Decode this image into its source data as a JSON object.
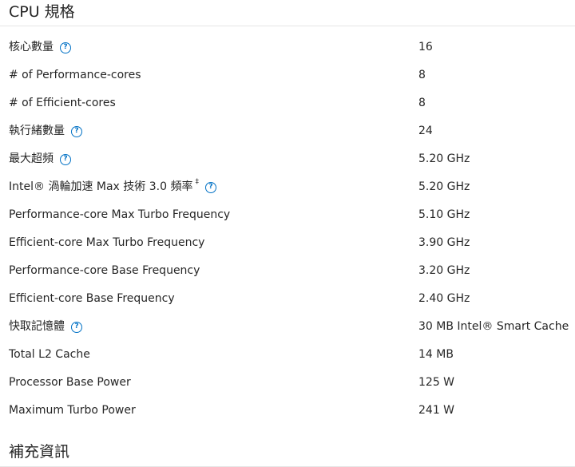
{
  "sections": {
    "cpu_specs_title": "CPU 規格",
    "extra_info_title": "補充資訊"
  },
  "specs": [
    {
      "label": "核心數量",
      "value": "16",
      "help": true,
      "mark": ""
    },
    {
      "label": "# of Performance-cores",
      "value": "8",
      "help": false,
      "mark": ""
    },
    {
      "label": "# of Efficient-cores",
      "value": "8",
      "help": false,
      "mark": ""
    },
    {
      "label": "執行緒數量",
      "value": "24",
      "help": true,
      "mark": ""
    },
    {
      "label": "最大超頻",
      "value": "5.20 GHz",
      "help": true,
      "mark": ""
    },
    {
      "label": "Intel® 渦輪加速 Max 技術 3.0 頻率",
      "value": "5.20 GHz",
      "help": true,
      "mark": "‡"
    },
    {
      "label": "Performance-core Max Turbo Frequency",
      "value": "5.10 GHz",
      "help": false,
      "mark": ""
    },
    {
      "label": "Efficient-core Max Turbo Frequency",
      "value": "3.90 GHz",
      "help": false,
      "mark": ""
    },
    {
      "label": "Performance-core Base Frequency",
      "value": "3.20 GHz",
      "help": false,
      "mark": ""
    },
    {
      "label": "Efficient-core Base Frequency",
      "value": "2.40 GHz",
      "help": false,
      "mark": ""
    },
    {
      "label": "快取記憶體",
      "value": "30 MB Intel® Smart Cache",
      "help": true,
      "mark": ""
    },
    {
      "label": "Total L2 Cache",
      "value": "14 MB",
      "help": false,
      "mark": ""
    },
    {
      "label": "Processor Base Power",
      "value": "125 W",
      "help": false,
      "mark": ""
    },
    {
      "label": "Maximum Turbo Power",
      "value": "241 W",
      "help": false,
      "mark": ""
    }
  ],
  "help_icon_glyph": "?",
  "colors": {
    "help_icon": "#0071c5",
    "text": "#262626",
    "rule": "#e6e6e6"
  }
}
